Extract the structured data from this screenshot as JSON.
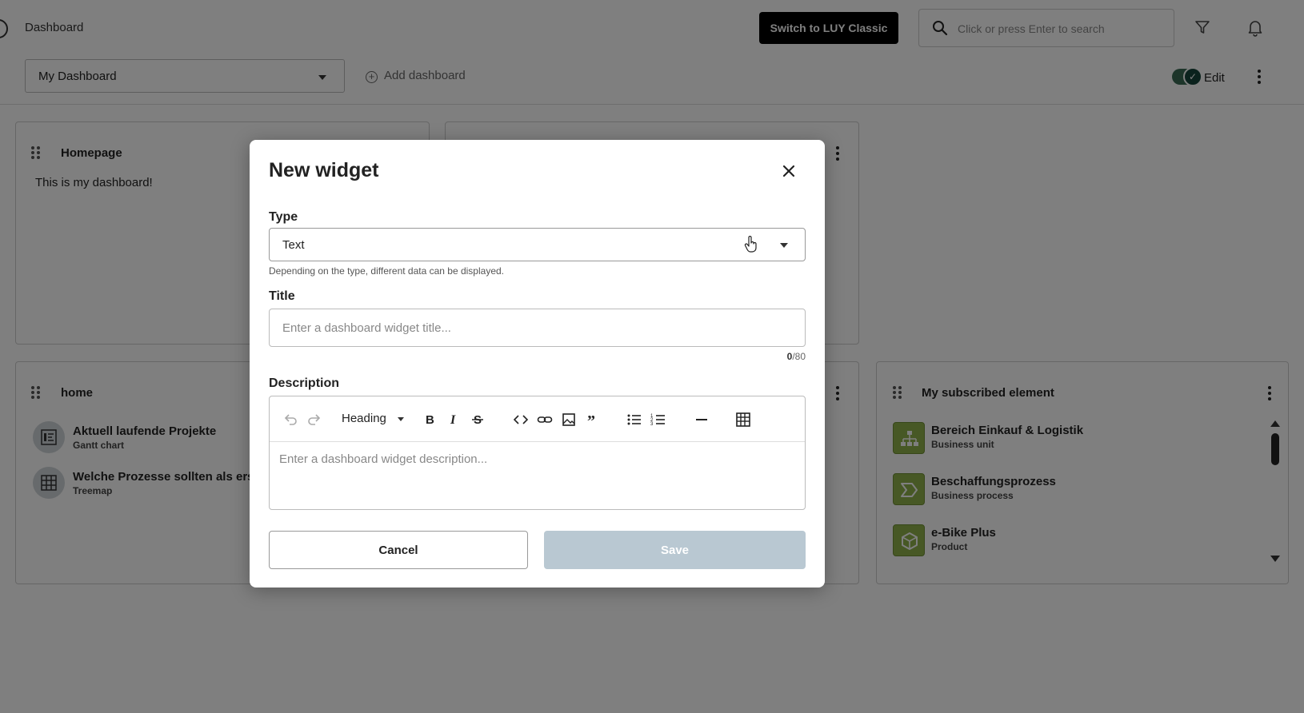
{
  "header": {
    "breadcrumb": "Dashboard",
    "switch_label": "Switch to LUY Classic",
    "search_placeholder": "Click or press Enter to search",
    "edit_label": "Edit",
    "edit_enabled": true
  },
  "dashboard": {
    "selected": "My Dashboard",
    "add_label": "Add dashboard"
  },
  "widgets": {
    "homepage": {
      "title": "Homepage",
      "text": "This is my dashboard!"
    },
    "home": {
      "title": "home",
      "items": [
        {
          "title": "Aktuell laufende Projekte",
          "subtitle": "Gantt chart",
          "icon": "gantt-icon"
        },
        {
          "title": "Welche Prozesse sollten als erste",
          "subtitle": "Treemap",
          "icon": "treemap-icon"
        }
      ]
    },
    "subscribed": {
      "title": "My subscribed element",
      "items": [
        {
          "title": "Bereich Einkauf & Logistik",
          "subtitle": "Business unit",
          "icon": "business-unit-icon"
        },
        {
          "title": "Beschaffungsprozess",
          "subtitle": "Business process",
          "icon": "business-process-icon"
        },
        {
          "title": "e-Bike Plus",
          "subtitle": "Product",
          "icon": "product-icon"
        }
      ]
    }
  },
  "modal": {
    "title": "New widget",
    "type_label": "Type",
    "type_value": "Text",
    "type_hint": "Depending on the type, different data can be displayed.",
    "title_label": "Title",
    "title_placeholder": "Enter a dashboard widget title...",
    "title_count": "0",
    "title_max": "/80",
    "description_label": "Description",
    "heading_label": "Heading",
    "description_placeholder": "Enter a dashboard widget description...",
    "cancel_label": "Cancel",
    "save_label": "Save"
  },
  "colors": {
    "accent_dark": "#000000",
    "toggle_on": "#16453a",
    "save_disabled": "#b9c8d2",
    "subscribed_icon": "#8fb04a"
  }
}
